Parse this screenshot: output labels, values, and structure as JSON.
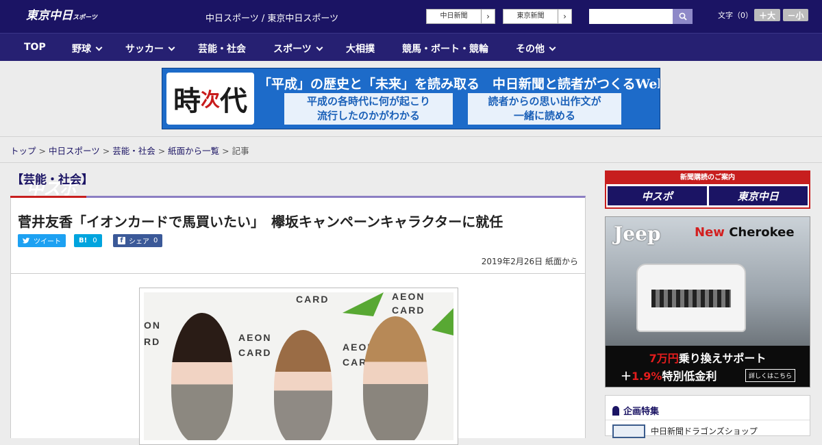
{
  "header": {
    "logo_main": "中スポ",
    "logo_sub": "東京中日",
    "logo_sub_small": "スポーツ",
    "site_links": "中日スポーツ / 東京中日スポーツ",
    "site_buttons": [
      {
        "label": "中日新聞",
        "arrow": "›"
      },
      {
        "label": "東京新聞",
        "arrow": "›"
      }
    ],
    "search_placeholder": "",
    "font_size_label": "文字（0）",
    "font_larger": "＋大",
    "font_smaller": "－小"
  },
  "nav": [
    {
      "label": "TOP",
      "has_dropdown": false
    },
    {
      "label": "野球",
      "has_dropdown": true
    },
    {
      "label": "サッカー",
      "has_dropdown": true
    },
    {
      "label": "芸能・社会",
      "has_dropdown": false
    },
    {
      "label": "スポーツ",
      "has_dropdown": true
    },
    {
      "label": "大相撲",
      "has_dropdown": false
    },
    {
      "label": "競馬・ボート・競輪",
      "has_dropdown": false
    },
    {
      "label": "その他",
      "has_dropdown": true
    }
  ],
  "banner": {
    "kanji_1": "時",
    "kanji_2": "次",
    "kanji_3": "代",
    "headline": "「平成」の歴史と「未来」を読み取る　中日新聞と読者がつくるWebサイト",
    "box_left_1": "平成の各時代に何が起こり",
    "box_left_2": "流行したのかがわかる",
    "box_right_1": "読者からの思い出作文が",
    "box_right_2": "一緒に読める"
  },
  "breadcrumb": {
    "items": [
      "トップ",
      "中日スポーツ",
      "芸能・社会",
      "紙面から一覧"
    ],
    "separator": ">",
    "current": "記事"
  },
  "article": {
    "section": "【芸能・社会】",
    "title": "菅井友香「イオンカードで馬買いたい」　欅坂キャンペーンキャラクターに就任",
    "share": {
      "tweet": "ツイート",
      "hatena": "B!",
      "hatena_count": "0",
      "facebook": "シェア",
      "facebook_count": "0"
    },
    "date": "2019年2月26日 紙面から",
    "photo_texts": [
      "AEON",
      "CARD",
      "AEON",
      "CARD",
      "CARD",
      "AEON",
      "CARD",
      "ON",
      "RD"
    ]
  },
  "sidebar": {
    "subscription_header": "新聞購読のご案内",
    "subscription_logos": [
      "中スポ",
      "東京中日"
    ],
    "ad": {
      "brand": "Jeep",
      "model_new": "New",
      "model_name": "Cherokee",
      "line1_amount": "7万円",
      "line1_rest": "乗り換えサポート",
      "line2_prefix": "＋",
      "line2_rate": "1.9%",
      "line2_rest": "特別低金利",
      "cta": "詳しくはこちら"
    },
    "kikaku_title": "企画特集",
    "kikaku_item": "中日新聞ドラゴンズショップ"
  },
  "colors": {
    "header_bg": "#1b1464",
    "nav_bg": "#262072",
    "accent_red": "#c71e1e",
    "accent_purple": "#8c7ec3"
  }
}
